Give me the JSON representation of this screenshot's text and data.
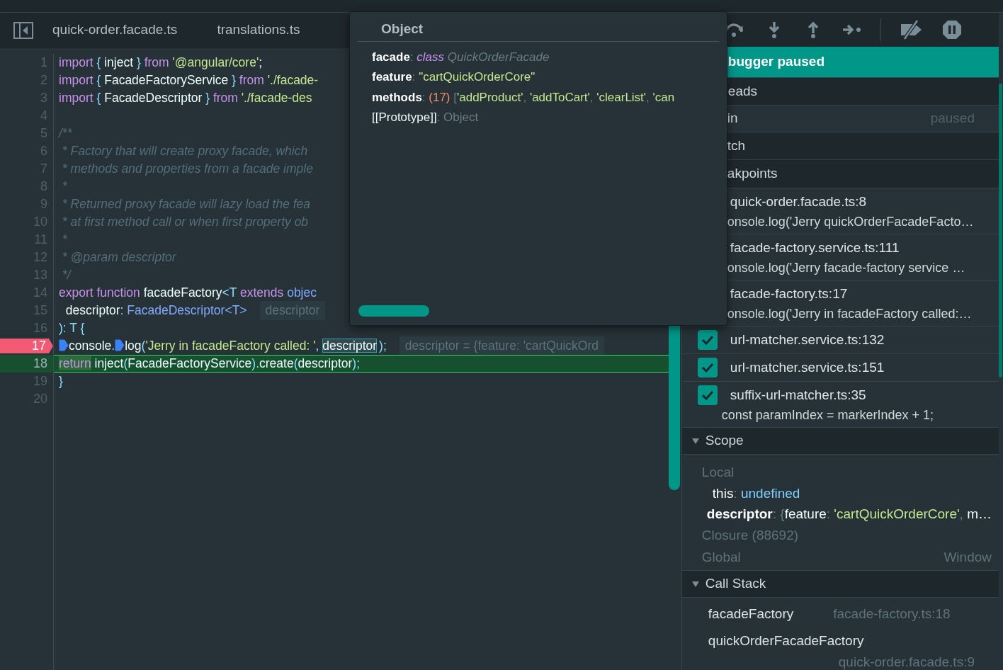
{
  "editor": {
    "tabs": [
      {
        "label": "quick-order.facade.ts"
      },
      {
        "label": "translations.ts"
      }
    ],
    "lines": [
      {
        "number": "1",
        "tokens": [
          {
            "kind": "keyword",
            "text": "import"
          },
          {
            "kind": "punct",
            "text": " { "
          },
          {
            "kind": "plain",
            "text": "inject"
          },
          {
            "kind": "punct",
            "text": " } "
          },
          {
            "kind": "keyword",
            "text": "from"
          },
          {
            "kind": "string",
            "text": " '@angular/core'"
          },
          {
            "kind": "plain",
            "text": ";"
          }
        ]
      },
      {
        "number": "2",
        "tokens": [
          {
            "kind": "keyword",
            "text": "import"
          },
          {
            "kind": "punct",
            "text": " { "
          },
          {
            "kind": "plain",
            "text": "FacadeFactoryService"
          },
          {
            "kind": "punct",
            "text": " } "
          },
          {
            "kind": "keyword",
            "text": "from"
          },
          {
            "kind": "string",
            "text": " './facade-"
          }
        ]
      },
      {
        "number": "3",
        "tokens": [
          {
            "kind": "keyword",
            "text": "import"
          },
          {
            "kind": "punct",
            "text": " { "
          },
          {
            "kind": "plain",
            "text": "FacadeDescriptor"
          },
          {
            "kind": "punct",
            "text": " } "
          },
          {
            "kind": "keyword",
            "text": "from"
          },
          {
            "kind": "string",
            "text": " './facade-des"
          }
        ]
      },
      {
        "number": "4"
      },
      {
        "number": "5",
        "tokens": [
          {
            "kind": "comment",
            "text": "/**"
          }
        ]
      },
      {
        "number": "6",
        "tokens": [
          {
            "kind": "comment",
            "text": " * Factory that will create proxy facade, which"
          }
        ]
      },
      {
        "number": "7",
        "tokens": [
          {
            "kind": "comment",
            "text": " * methods and properties from a facade imple"
          }
        ]
      },
      {
        "number": "8",
        "tokens": [
          {
            "kind": "comment",
            "text": " *"
          }
        ]
      },
      {
        "number": "9",
        "tokens": [
          {
            "kind": "comment",
            "text": " * Returned proxy facade will lazy load the fea"
          }
        ]
      },
      {
        "number": "10",
        "tokens": [
          {
            "kind": "comment",
            "text": " * at first method call or when first property ob"
          }
        ]
      },
      {
        "number": "11",
        "tokens": [
          {
            "kind": "comment",
            "text": " *"
          }
        ]
      },
      {
        "number": "12",
        "tokens": [
          {
            "kind": "comment",
            "text": " * @param descriptor"
          }
        ]
      },
      {
        "number": "13",
        "tokens": [
          {
            "kind": "comment",
            "text": " */"
          }
        ]
      },
      {
        "number": "14",
        "tokens": [
          {
            "kind": "keyword",
            "text": "export function"
          },
          {
            "kind": "plain",
            "text": " facadeFactory"
          },
          {
            "kind": "punct",
            "text": "<T"
          },
          {
            "kind": "keyword",
            "text": " extends"
          },
          {
            "kind": "type",
            "text": " objec"
          }
        ]
      },
      {
        "number": "15",
        "tokens": [
          {
            "kind": "plain",
            "text": "  descriptor"
          },
          {
            "kind": "punct",
            "text": ": "
          },
          {
            "kind": "type",
            "text": "FacadeDescriptor<T>"
          }
        ],
        "hint": "descriptor"
      },
      {
        "number": "16",
        "tokens": [
          {
            "kind": "punct",
            "text": "): T {"
          }
        ]
      },
      {
        "number": "17",
        "breakpoint": true,
        "tokens": [
          {
            "kind": "marker"
          },
          {
            "kind": "plain",
            "text": "console"
          },
          {
            "kind": "punct",
            "text": "."
          },
          {
            "kind": "marker"
          },
          {
            "kind": "plain",
            "text": "log"
          },
          {
            "kind": "punct",
            "text": "("
          },
          {
            "kind": "string",
            "text": "'Jerry in facadeFactory called: '"
          },
          {
            "kind": "punct",
            "text": ", "
          },
          {
            "kind": "plain",
            "text": "descriptor",
            "highlighted": true
          },
          {
            "kind": "punct",
            "text": ");"
          }
        ],
        "hint": "descriptor = {feature: 'cartQuickOrd"
      },
      {
        "number": "18",
        "current": true,
        "tokens": [
          {
            "kind": "keyword",
            "text": "return",
            "highlighted": true
          },
          {
            "kind": "plain",
            "text": " inject"
          },
          {
            "kind": "punct",
            "text": "("
          },
          {
            "kind": "plain",
            "text": "FacadeFactoryService"
          },
          {
            "kind": "punct",
            "text": ")."
          },
          {
            "kind": "plain",
            "text": "create"
          },
          {
            "kind": "punct",
            "text": "("
          },
          {
            "kind": "plain",
            "text": "descriptor"
          },
          {
            "kind": "punct",
            "text": ");"
          }
        ]
      },
      {
        "number": "19",
        "tokens": [
          {
            "kind": "punct",
            "text": "}"
          }
        ]
      },
      {
        "number": "20"
      }
    ]
  },
  "tooltip": {
    "title": "Object",
    "properties": [
      {
        "name": "facade",
        "internal": false,
        "parts": [
          {
            "kind": "muted",
            "text": ": "
          },
          {
            "kind": "keyword",
            "text": "class"
          },
          {
            "kind": "muted",
            "text": " QuickOrderFacade"
          }
        ]
      },
      {
        "name": "feature",
        "internal": false,
        "parts": [
          {
            "kind": "muted",
            "text": ": "
          },
          {
            "kind": "string",
            "text": "\"cartQuickOrderCore\""
          }
        ]
      },
      {
        "name": "methods",
        "internal": false,
        "parts": [
          {
            "kind": "muted",
            "text": ": "
          },
          {
            "kind": "number",
            "text": "(17) "
          },
          {
            "kind": "muted",
            "text": "["
          },
          {
            "kind": "string",
            "text": "'addProduct'"
          },
          {
            "kind": "muted",
            "text": ", "
          },
          {
            "kind": "string",
            "text": "'addToCart'"
          },
          {
            "kind": "muted",
            "text": ", "
          },
          {
            "kind": "string",
            "text": "'clearList'"
          },
          {
            "kind": "muted",
            "text": ", "
          },
          {
            "kind": "string",
            "text": "'can"
          }
        ]
      },
      {
        "name": "[[Prototype]]",
        "internal": true,
        "parts": [
          {
            "kind": "muted",
            "text": ": Object"
          }
        ]
      }
    ]
  },
  "debug_panel": {
    "banner": "bugger paused",
    "threads": {
      "header": "eads",
      "rows": [
        {
          "name": "in",
          "status": "paused"
        }
      ]
    },
    "watch": {
      "header": "tch"
    },
    "breakpoints": {
      "header": "akpoints",
      "items": [
        {
          "location": "quick-order.facade.ts:8",
          "code": "onsole.log('Jerry quickOrderFacadeFacto…"
        },
        {
          "location": "facade-factory.service.ts:111",
          "code": "onsole.log('Jerry facade-factory service …"
        },
        {
          "location": "facade-factory.ts:17",
          "code": "onsole.log('Jerry in facadeFactory called:…"
        },
        {
          "location": "url-matcher.service.ts:132",
          "checked": true
        },
        {
          "location": "url-matcher.service.ts:151",
          "checked": true
        },
        {
          "location": "suffix-url-matcher.ts:35",
          "checked": true,
          "code": "const paramIndex = markerIndex + 1;"
        }
      ]
    },
    "scope": {
      "header": "Scope",
      "expanded": true,
      "items": [
        {
          "kind": "group",
          "label": "Local"
        },
        {
          "kind": "variable",
          "name": "this",
          "bold": false,
          "parts": [
            {
              "kind": "muted",
              "text": ": "
            },
            {
              "kind": "keyword_value",
              "text": "undefined"
            }
          ]
        },
        {
          "kind": "variable",
          "name": "descriptor",
          "bold": true,
          "parts": [
            {
              "kind": "muted",
              "text": ": {"
            },
            {
              "kind": "plain",
              "text": "feature"
            },
            {
              "kind": "muted",
              "text": ": "
            },
            {
              "kind": "string",
              "text": "'cartQuickOrderCore'"
            },
            {
              "kind": "muted",
              "text": ", "
            },
            {
              "kind": "plain",
              "text": "m…"
            }
          ]
        },
        {
          "kind": "group",
          "label": "Closure (88692)"
        },
        {
          "kind": "group",
          "label": "Global",
          "value": "Window"
        }
      ]
    },
    "call_stack": {
      "header": "Call Stack",
      "expanded": true,
      "frames": [
        {
          "name": "facadeFactory",
          "location": "facade-factory.ts:18",
          "wrap": false
        },
        {
          "name": "quickOrderFacadeFactory",
          "location": "quick-order.facade.ts:9",
          "wrap": true
        }
      ]
    }
  }
}
